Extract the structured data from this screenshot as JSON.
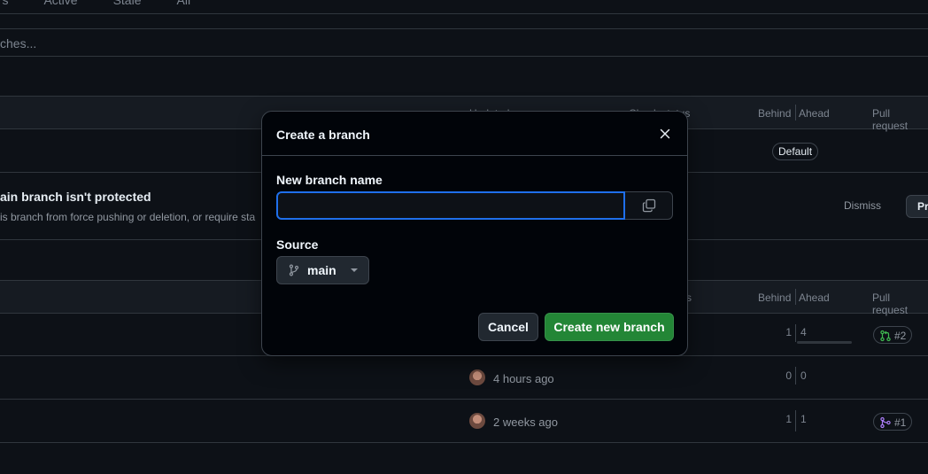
{
  "filters": {
    "tabs": [
      "urs",
      "Active",
      "Stale",
      "All"
    ]
  },
  "search": {
    "placeholder": "ches..."
  },
  "table1": {
    "headers": {
      "updated": "Updated",
      "check_status": "Check status",
      "behind": "Behind",
      "ahead": "Ahead",
      "pull_request": "Pull request"
    },
    "default_badge": "Default"
  },
  "protection_banner": {
    "title": "ain branch isn't protected",
    "description": "is branch from force pushing or deletion, or require sta",
    "dismiss": "Dismiss",
    "protect": "Pr"
  },
  "table2": {
    "headers": {
      "check_status": "s",
      "behind": "Behind",
      "ahead": "Ahead",
      "pull_request": "Pull request"
    },
    "rows": [
      {
        "updated": "",
        "behind": "1",
        "ahead": "4",
        "pr": "#2",
        "pr_state": "open"
      },
      {
        "updated": "4 hours ago",
        "behind": "0",
        "ahead": "0",
        "pr": "",
        "pr_state": ""
      },
      {
        "updated": "2 weeks ago",
        "behind": "1",
        "ahead": "1",
        "pr": "#1",
        "pr_state": "merged"
      }
    ]
  },
  "dialog": {
    "title": "Create a branch",
    "name_label": "New branch name",
    "name_value": "",
    "source_label": "Source",
    "source_branch": "main",
    "cancel": "Cancel",
    "create": "Create new branch"
  },
  "colors": {
    "background": "#0d1117",
    "accent_blue": "#1f6feb",
    "primary_green": "#238636",
    "pr_open": "#3fb950",
    "pr_merged": "#ab7df8"
  },
  "icons": {
    "close": "x-icon",
    "copy": "copy-icon",
    "branch": "git-branch-icon",
    "pr_open": "git-pull-request-icon",
    "pr_merged": "git-merge-icon"
  }
}
